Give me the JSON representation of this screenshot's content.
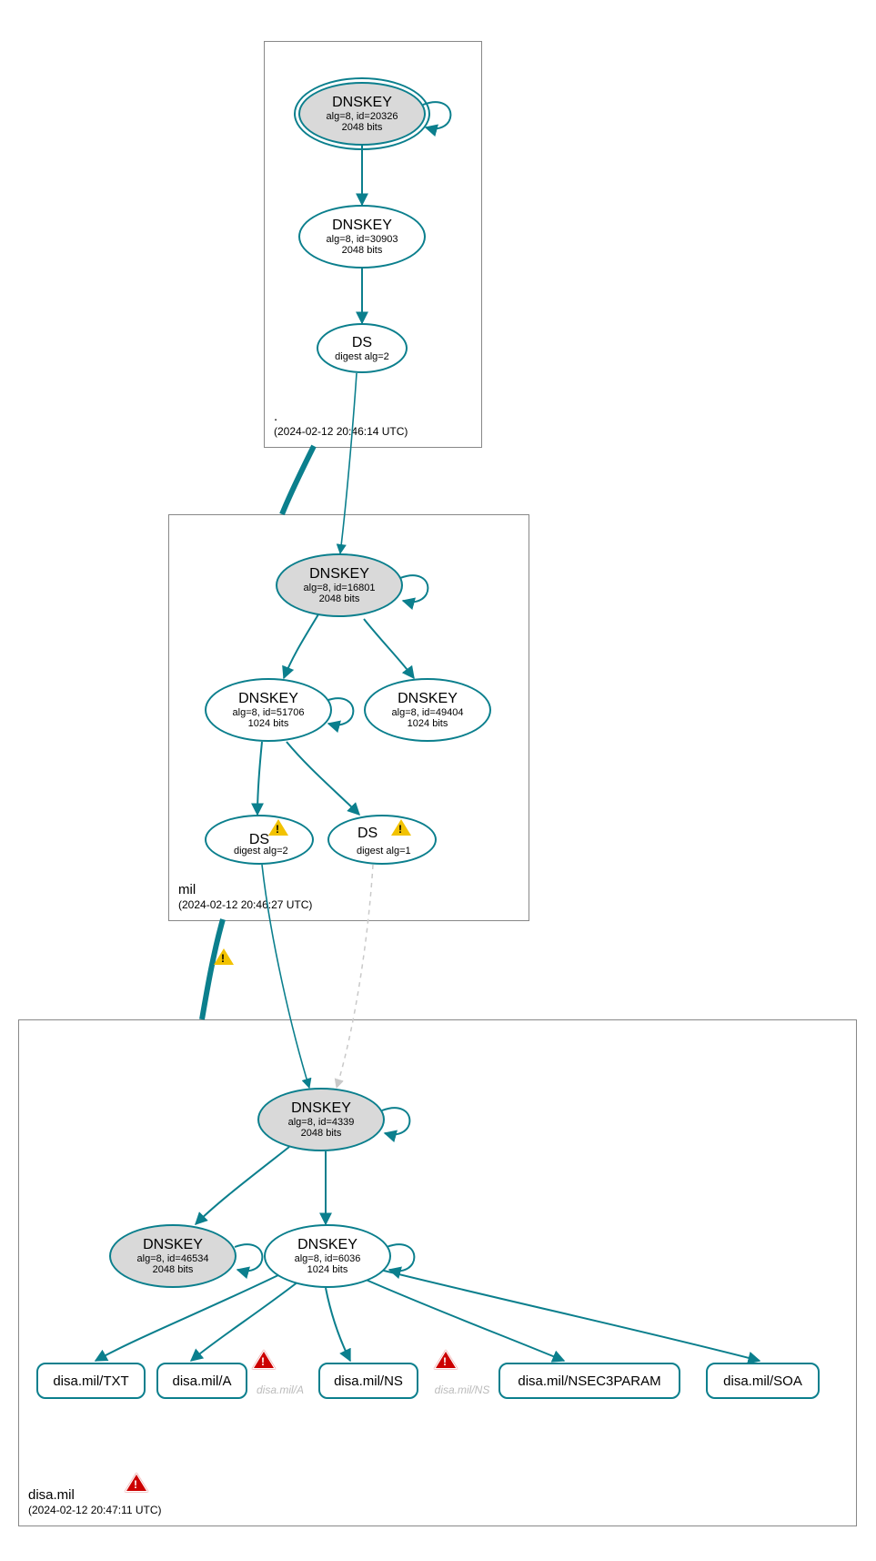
{
  "zones": {
    "root": {
      "name": ".",
      "timestamp": "(2024-02-12 20:46:14 UTC)"
    },
    "mil": {
      "name": "mil",
      "timestamp": "(2024-02-12 20:46:27 UTC)"
    },
    "disa": {
      "name": "disa.mil",
      "timestamp": "(2024-02-12 20:47:11 UTC)"
    }
  },
  "nodes": {
    "root_ksk": {
      "title": "DNSKEY",
      "line2": "alg=8, id=20326",
      "line3": "2048 bits"
    },
    "root_zsk": {
      "title": "DNSKEY",
      "line2": "alg=8, id=30903",
      "line3": "2048 bits"
    },
    "root_ds": {
      "title": "DS",
      "line2": "digest alg=2"
    },
    "mil_ksk": {
      "title": "DNSKEY",
      "line2": "alg=8, id=16801",
      "line3": "2048 bits"
    },
    "mil_zsk1": {
      "title": "DNSKEY",
      "line2": "alg=8, id=51706",
      "line3": "1024 bits"
    },
    "mil_zsk2": {
      "title": "DNSKEY",
      "line2": "alg=8, id=49404",
      "line3": "1024 bits"
    },
    "mil_ds1": {
      "title": "DS",
      "line2": "digest alg=2"
    },
    "mil_ds2": {
      "title": "DS",
      "line2": "digest alg=1"
    },
    "disa_ksk": {
      "title": "DNSKEY",
      "line2": "alg=8, id=4339",
      "line3": "2048 bits"
    },
    "disa_k2": {
      "title": "DNSKEY",
      "line2": "alg=8, id=46534",
      "line3": "2048 bits"
    },
    "disa_zsk": {
      "title": "DNSKEY",
      "line2": "alg=8, id=6036",
      "line3": "1024 bits"
    }
  },
  "records": {
    "txt": "disa.mil/TXT",
    "a": "disa.mil/A",
    "ns": "disa.mil/NS",
    "n3p": "disa.mil/NSEC3PARAM",
    "soa": "disa.mil/SOA"
  },
  "ghosts": {
    "a": "disa.mil/A",
    "ns": "disa.mil/NS"
  },
  "colors": {
    "stroke": "#0b7f8d"
  }
}
